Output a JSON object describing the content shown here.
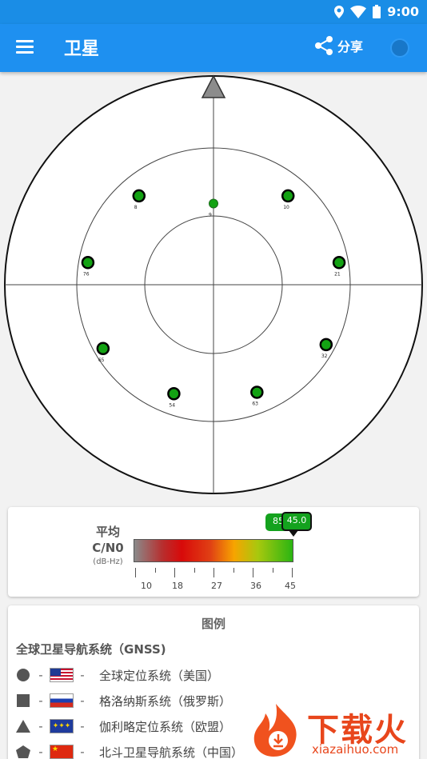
{
  "status_bar": {
    "time": "9:00",
    "icons": [
      "location-icon",
      "wifi-icon",
      "battery-icon"
    ]
  },
  "app_bar": {
    "title": "卫星",
    "share_label": "分享",
    "background": "#1e90f0"
  },
  "sky_plot": {
    "north_marker": "triangle",
    "satellites": [
      {
        "id": "9",
        "azimuth": 0,
        "elevation": 55
      },
      {
        "id": "10",
        "azimuth": 40,
        "elevation": 40
      },
      {
        "id": "21",
        "azimuth": 80,
        "elevation": 35
      },
      {
        "id": "32",
        "azimuth": 118,
        "elevation": 35
      },
      {
        "id": "63",
        "azimuth": 158,
        "elevation": 40
      },
      {
        "id": "54",
        "azimuth": 200,
        "elevation": 40
      },
      {
        "id": "65",
        "azimuth": 240,
        "elevation": 35
      },
      {
        "id": "76",
        "azimuth": 280,
        "elevation": 35
      },
      {
        "id": "8",
        "azimuth": 320,
        "elevation": 40
      }
    ]
  },
  "cn0": {
    "title": "平均",
    "label": "C/N0",
    "unit": "(dB-Hz)",
    "ticks": [
      "10",
      "18",
      "27",
      "36",
      "45"
    ],
    "marker_back": "85",
    "marker_front": "45.0"
  },
  "legend": {
    "title": "图例",
    "subtitle": "全球卫星导航系统（GNSS)",
    "items": [
      {
        "shape": "circle",
        "dash": "-",
        "name": "全球定位系统（美国）"
      },
      {
        "shape": "square",
        "dash": "-",
        "name": "格洛纳斯系统（俄罗斯）"
      },
      {
        "shape": "triangle",
        "dash": "-",
        "name": "伽利略定位系统（欧盟）"
      },
      {
        "shape": "pentagon",
        "dash": "-",
        "name": "北斗卫星导航系统（中国）"
      }
    ]
  },
  "watermark": {
    "brand": "下载火",
    "domain": "xiazaihuo.com"
  }
}
